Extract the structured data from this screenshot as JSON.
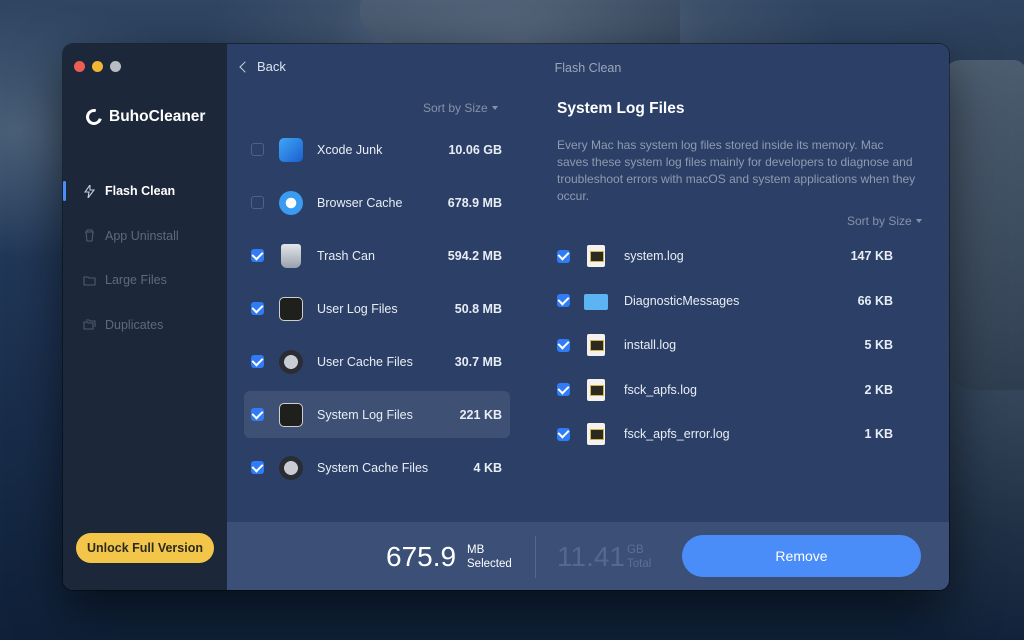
{
  "app": {
    "name": "BuhoCleaner"
  },
  "window": {
    "title": "Flash Clean",
    "back_label": "Back"
  },
  "sidebar": {
    "items": [
      {
        "label": "Flash Clean",
        "icon": "flash-icon",
        "active": true
      },
      {
        "label": "App Uninstall",
        "icon": "trash-icon",
        "active": false
      },
      {
        "label": "Large Files",
        "icon": "folder-icon",
        "active": false
      },
      {
        "label": "Duplicates",
        "icon": "duplicates-icon",
        "active": false
      }
    ],
    "unlock_label": "Unlock Full Version"
  },
  "categories": {
    "sort_label": "Sort by Size",
    "items": [
      {
        "name": "Xcode Junk",
        "size": "10.06 GB",
        "checked": false,
        "icon": "xcode-icon"
      },
      {
        "name": "Browser Cache",
        "size": "678.9 MB",
        "checked": false,
        "icon": "safari-icon"
      },
      {
        "name": "Trash Can",
        "size": "594.2 MB",
        "checked": true,
        "icon": "trash-can-icon"
      },
      {
        "name": "User Log Files",
        "size": "50.8 MB",
        "checked": true,
        "icon": "console-log-icon"
      },
      {
        "name": "User Cache Files",
        "size": "30.7 MB",
        "checked": true,
        "icon": "cache-clock-icon"
      },
      {
        "name": "System Log Files",
        "size": "221 KB",
        "checked": true,
        "icon": "console-gear-icon",
        "selected": true
      },
      {
        "name": "System Cache Files",
        "size": "4 KB",
        "checked": true,
        "icon": "cache-gear-icon"
      }
    ]
  },
  "detail": {
    "title": "System Log Files",
    "description": "Every Mac has system log files stored inside its memory. Mac saves these system log files mainly for developers to diagnose and troubleshoot errors with macOS and system applications when they occur.",
    "sort_label": "Sort by Size",
    "files": [
      {
        "name": "system.log",
        "size": "147 KB",
        "checked": true,
        "icon": "log-file-icon"
      },
      {
        "name": "DiagnosticMessages",
        "size": "66 KB",
        "checked": true,
        "icon": "folder-icon"
      },
      {
        "name": "install.log",
        "size": "5 KB",
        "checked": true,
        "icon": "log-file-icon"
      },
      {
        "name": "fsck_apfs.log",
        "size": "2 KB",
        "checked": true,
        "icon": "log-file-icon"
      },
      {
        "name": "fsck_apfs_error.log",
        "size": "1 KB",
        "checked": true,
        "icon": "log-file-icon"
      }
    ]
  },
  "footer": {
    "selected_value": "675.9",
    "selected_unit": "MB",
    "selected_label": "Selected",
    "total_value": "11.41",
    "total_unit": "GB",
    "total_label": "Total",
    "remove_label": "Remove"
  },
  "colors": {
    "accent": "#4b8df8",
    "unlock": "#f3c64a",
    "sidebar": "#1c2839",
    "panel": "#2c4067"
  }
}
